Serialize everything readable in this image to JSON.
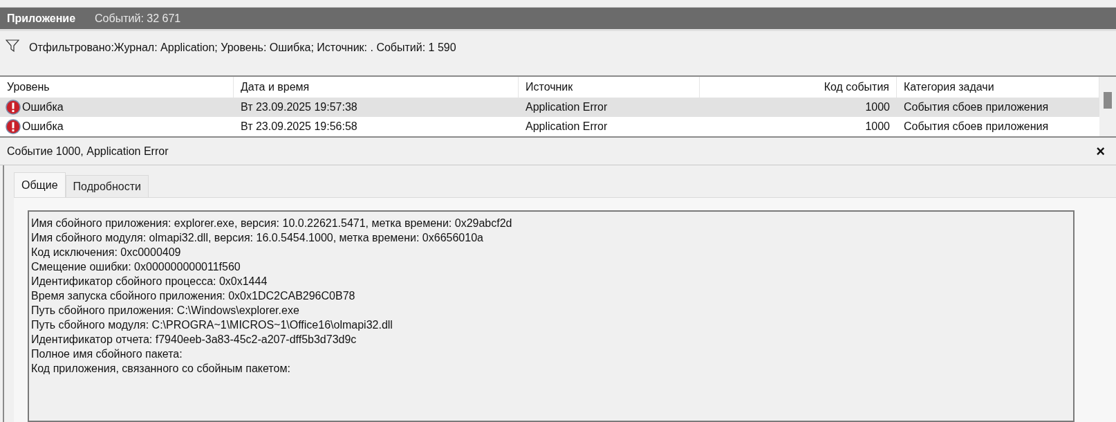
{
  "header": {
    "title": "Приложение",
    "count": "Событий: 32 671"
  },
  "filter": {
    "text": "Отфильтровано:Журнал: Application; Уровень: Ошибка; Источник: . Событий: 1 590"
  },
  "table": {
    "columns": [
      "Уровень",
      "Дата и время",
      "Источник",
      "Код события",
      "Категория задачи"
    ],
    "rows": [
      {
        "level": "Ошибка",
        "datetime": "Вт 23.09.2025 19:57:38",
        "source": "Application Error",
        "event_id": "1000",
        "category": "События сбоев приложения",
        "selected": true
      },
      {
        "level": "Ошибка",
        "datetime": "Вт 23.09.2025 19:56:58",
        "source": "Application Error",
        "event_id": "1000",
        "category": "События сбоев приложения",
        "selected": false
      }
    ]
  },
  "details": {
    "title": "Событие 1000, Application Error",
    "close": "×",
    "tabs": [
      {
        "label": "Общие",
        "selected": true
      },
      {
        "label": "Подробности",
        "selected": false
      }
    ],
    "lines": [
      "Имя сбойного приложения: explorer.exe, версия: 10.0.22621.5471, метка времени: 0x29abcf2d",
      "Имя сбойного модуля: olmapi32.dll, версия: 16.0.5454.1000, метка времени: 0x6656010a",
      "Код исключения: 0xc0000409",
      "Смещение ошибки: 0x000000000011f560",
      "Идентификатор сбойного процесса: 0x0x1444",
      "Время запуска сбойного приложения: 0x0x1DC2CAB296C0B78",
      "Путь сбойного приложения: C:\\Windows\\explorer.exe",
      "Путь сбойного модуля: C:\\PROGRA~1\\MICROS~1\\Office16\\olmapi32.dll",
      "Идентификатор отчета: f7940eeb-3a83-45c2-a207-dff5b3d73d9c",
      "Полное имя сбойного пакета:",
      "Код приложения, связанного со сбойным пакетом:"
    ]
  }
}
